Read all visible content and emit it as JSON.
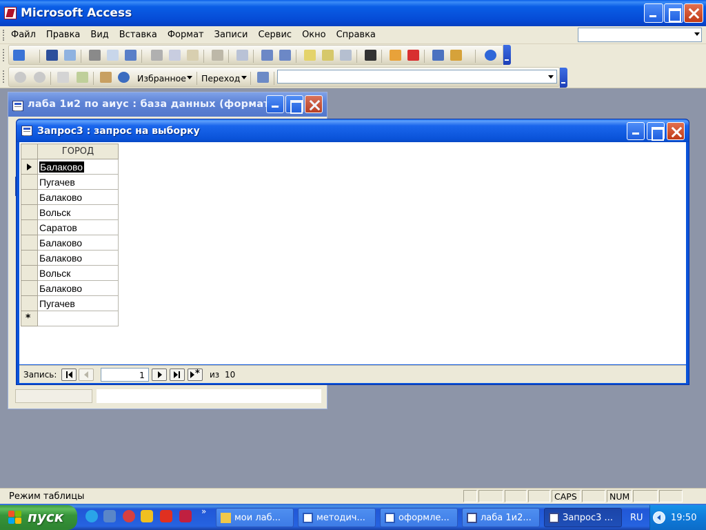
{
  "app": {
    "title": "Microsoft Access"
  },
  "menu": {
    "items": [
      "Файл",
      "Правка",
      "Вид",
      "Вставка",
      "Формат",
      "Записи",
      "Сервис",
      "Окно",
      "Справка"
    ]
  },
  "toolbar2": {
    "favorites_label": "Избранное",
    "goto_label": "Переход"
  },
  "db_window": {
    "title": "лаба 1и2 по аиус : база данных (формат..."
  },
  "query_window": {
    "title": "Запрос3 : запрос на выборку",
    "column_header": "ГОРОД",
    "rows": [
      "Балаково",
      "Пугачев",
      "Балаково",
      "Вольск",
      "Саратов",
      "Балаково",
      "Балаково",
      "Вольск",
      "Балаково",
      "Пугачев"
    ],
    "new_row_marker": "*",
    "navigation": {
      "label": "Запись:",
      "current_record": "1",
      "of_label": "из",
      "total_records": "10"
    }
  },
  "status_bar": {
    "mode_text": "Режим таблицы",
    "caps": "CAPS",
    "num": "NUM"
  },
  "taskbar": {
    "start_label": "пуск",
    "buttons": [
      "мои лаб...",
      "методич...",
      "оформле...",
      "лаба 1и2...",
      "Запрос3 ..."
    ],
    "quicklaunch_more": "»",
    "language": "RU",
    "clock": "19:50"
  },
  "colors": {
    "xp_blue": "#0a53d9",
    "chrome": "#ece9d8",
    "desktop_mdi": "#8d95a8",
    "start_green": "#37953a"
  }
}
